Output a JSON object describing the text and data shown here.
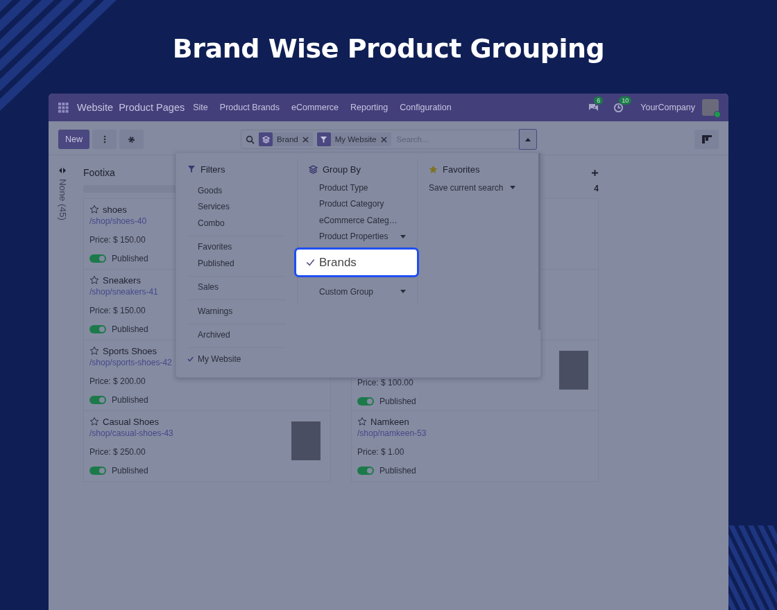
{
  "heading": "Brand Wise Product Grouping",
  "navbar": {
    "app_name": "Website",
    "breadcrumb": "Product Pages",
    "menu": [
      "Site",
      "Product Brands",
      "eCommerce",
      "Reporting",
      "Configuration"
    ],
    "messages_badge": "6",
    "activities_badge": "10",
    "company": "YourCompany"
  },
  "control_panel": {
    "new_button": "New"
  },
  "search": {
    "facets": [
      {
        "kind": "group",
        "label": "Brand"
      },
      {
        "kind": "filter",
        "label": "My Website"
      }
    ],
    "placeholder": "Search..."
  },
  "folded_column": {
    "label": "None (45)"
  },
  "columns": [
    {
      "title": "Footixa",
      "level": 0,
      "cards": [
        {
          "name": "shoes",
          "url": "/shop/shoes-40",
          "price": "Price: $ 150.00",
          "published": true,
          "status": "Published",
          "photo": false
        },
        {
          "name": "Sneakers",
          "url": "/shop/sneakers-41",
          "price": "Price: $ 150.00",
          "published": true,
          "status": "Published",
          "photo": false
        },
        {
          "name": "Sports Shoes",
          "url": "/shop/sports-shoes-42",
          "price": "Price: $ 200.00",
          "published": true,
          "status": "Published",
          "photo": false
        },
        {
          "name": "Casual Shoes",
          "url": "/shop/casual-shoes-43",
          "price": "Price: $ 250.00",
          "published": true,
          "status": "Published",
          "photo": true
        }
      ]
    },
    {
      "count": "4",
      "cards": [
        {
          "hidden": true
        },
        {
          "hidden": true
        },
        {
          "price": "Price: $ 100.00",
          "published": true,
          "status": "Published",
          "photo": true
        },
        {
          "name": "Namkeen",
          "url": "/shop/namkeen-53",
          "price": "Price: $ 1.00",
          "published": true,
          "status": "Published",
          "photo": false
        }
      ]
    }
  ],
  "dropdown": {
    "filters": {
      "title": "Filters",
      "groups": [
        [
          {
            "label": "Goods",
            "checked": false
          },
          {
            "label": "Services",
            "checked": false
          },
          {
            "label": "Combo",
            "checked": false
          }
        ],
        [
          {
            "label": "Favorites",
            "checked": false
          },
          {
            "label": "Published",
            "checked": false
          }
        ],
        [
          {
            "label": "Sales",
            "checked": false
          }
        ],
        [
          {
            "label": "Warnings",
            "checked": false
          }
        ],
        [
          {
            "label": "Archived",
            "checked": false
          }
        ],
        [
          {
            "label": "My Website",
            "checked": true
          }
        ]
      ]
    },
    "group_by": {
      "title": "Group By",
      "items": [
        {
          "label": "Product Type",
          "checked": false,
          "highlighted": false,
          "submenu": false
        },
        {
          "label": "Product Category",
          "checked": false,
          "highlighted": false,
          "submenu": false
        },
        {
          "label": "eCommerce Categ…",
          "checked": false,
          "highlighted": false,
          "submenu": false
        },
        {
          "label": "Product Properties",
          "checked": false,
          "highlighted": false,
          "submenu": true
        },
        {
          "label": "Brands",
          "checked": true,
          "highlighted": true,
          "submenu": false
        },
        {
          "label": "Custom Group",
          "checked": false,
          "highlighted": false,
          "submenu": true
        }
      ]
    },
    "favorites": {
      "title": "Favorites",
      "items": [
        {
          "label": "Save current search",
          "submenu": true
        }
      ]
    }
  }
}
